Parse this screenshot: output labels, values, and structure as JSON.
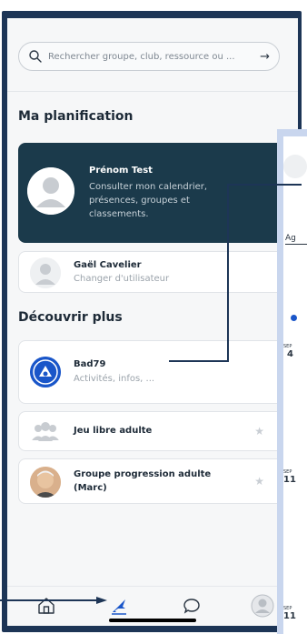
{
  "search": {
    "placeholder": "Rechercher groupe, club, ressource ou ..."
  },
  "sections": {
    "planning": "Ma planification",
    "discover": "Découvrir plus"
  },
  "profile_card": {
    "name": "Prénom Test",
    "description": "Consulter mon calendrier, présences, groupes et classements."
  },
  "user_card": {
    "name": "Gaël Cavelier",
    "subtitle": "Changer d'utilisateur"
  },
  "club_card": {
    "name": "Bad79",
    "subtitle": "Activités, infos, ..."
  },
  "group_cards": [
    {
      "name": "Jeu libre adulte"
    },
    {
      "name": "Groupe progression adulte (Marc)"
    }
  ],
  "bottom_nav": {
    "items": [
      "home-icon",
      "shuttlecock-icon",
      "chat-icon",
      "profile-icon"
    ],
    "active": "shuttlecock-icon"
  },
  "second_screen": {
    "tab_fragment": "Ag",
    "date_labels": [
      "SEP",
      "SEP",
      "SEP"
    ],
    "numbers": [
      "4",
      "11",
      "11"
    ]
  },
  "colors": {
    "frame": "#1d3556",
    "dark_card": "#1b3a4b",
    "accent_blue": "#1a56c9"
  }
}
